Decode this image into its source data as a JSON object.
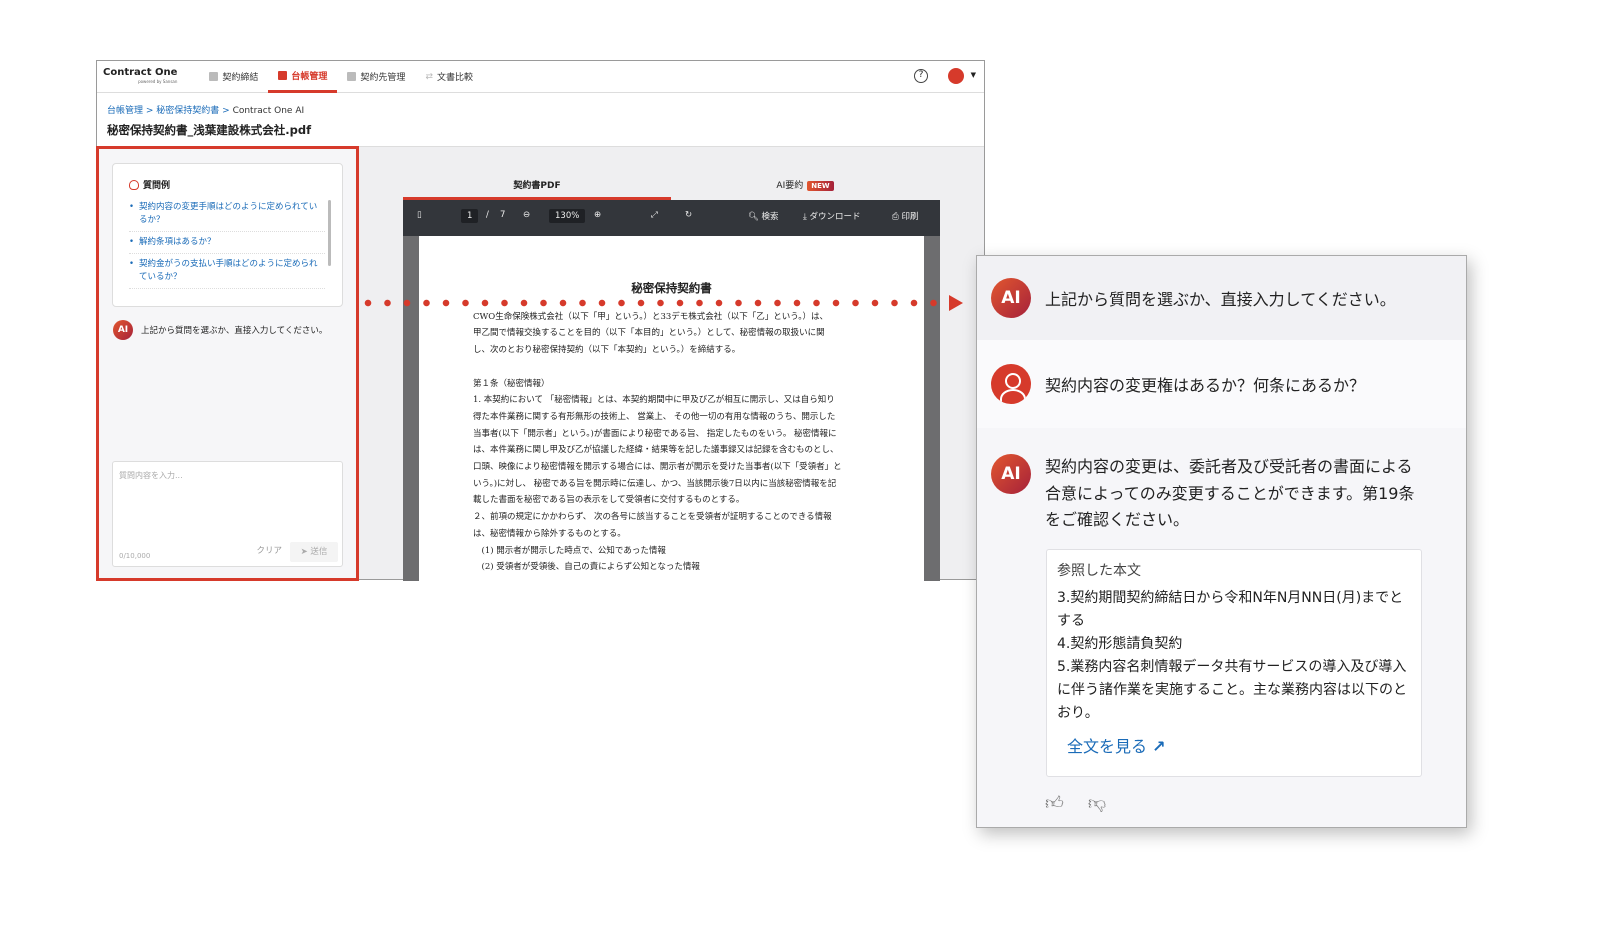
{
  "nav": {
    "logo": "Contract One",
    "logo_sub": "powered by Sansan",
    "items": [
      "契約締結",
      "台帳管理",
      "契約先管理",
      "文書比較"
    ],
    "active": 1,
    "help": "?"
  },
  "breadcrumb": [
    "台帳管理",
    "秘密保持契約書",
    "Contract One AI"
  ],
  "doc_title": "秘密保持契約書_浅葉建設株式会社.pdf",
  "left": {
    "examples_title": "質問例",
    "examples": [
      "契約内容の変更手順はどのように定められているか？",
      "解約条項はあるか？",
      "契約金がうの支払い手順はどのように定められているか？"
    ],
    "ai_badge": "AI",
    "ai_message": "上記から質問を選ぶか、直接入力してください。",
    "input_placeholder": "質問内容を入力...",
    "counter": "0/10,000",
    "clear": "クリア",
    "send": "送信"
  },
  "tabs": {
    "pdf": "契約書PDF",
    "summary": "AI要約",
    "new_badge": "NEW"
  },
  "toolbar": {
    "page": "1",
    "sep": "/",
    "total": "7",
    "zoom": "130%",
    "search": "検索",
    "download": "ダウンロード",
    "print": "印刷"
  },
  "pdf": {
    "title": "秘密保持契約書",
    "lines": [
      "CWO生命保険株式会社（以下「甲」という。）と33デモ株式会社（以下「乙」という。）は、",
      "甲乙間で情報交換することを目的（以下「本目的」という。）として、秘密情報の取扱いに関",
      "し、次のとおり秘密保持契約（以下「本契約」という。）を締結する。",
      "",
      "第１条（秘密情報）",
      "1. 本契約において 「秘密情報」とは、本契約期間中に甲及び乙が相互に開示し、又は自ら知り",
      "得た本件業務に関する有形無形の技術上、 営業上、 その他一切の有用な情報のうち、開示した",
      "当事者(以下「開示者」という。)が書面により秘密である旨、 指定したものをいう。 秘密情報に",
      "は、本件業務に関し甲及び乙が協議した経緯・結果等を記した議事録又は記録を含むものとし、",
      "口頭、映像により秘密情報を開示する場合には、開示者が開示を受けた当事者(以下「受領者」と",
      "いう。)に対し、 秘密である旨を開示時に伝達し、かつ、当該開示後7日以内に当該秘密情報を記",
      "載した書面を秘密である旨の表示をして受領者に交付するものとする。",
      "２、前項の規定にかかわらず、 次の各号に該当することを受領者が証明することのできる情報",
      "は、秘密情報から除外するものとする。",
      "　(1) 開示者が開示した時点で、公知であった情報",
      "　(2) 受領者が受領後、自己の責によらず公知となった情報"
    ]
  },
  "callout": {
    "ai_badge": "AI",
    "msg1": "上記から質問を選ぶか、直接入力してください。",
    "user_msg": "契約内容の変更権はあるか？何条にあるか？",
    "answer": "契約内容の変更は、委託者及び受託者の書面による合意によってのみ変更することができます。第19条をご確認ください。",
    "ref_title": "参照した本文",
    "ref_lines": [
      "3.契約期間契約締結日から令和N年N月NN日(月)までとする",
      "4.契約形態請負契約",
      "5.業務内容名刺情報データ共有サービスの導入及び導入に伴う諸作業を実施すること。主な業務内容は以下のとおり。"
    ],
    "full_text_link": "全文を見る"
  },
  "colors": {
    "accent": "#d63a2b",
    "link": "#1a6bb8",
    "toolbar": "#33363b"
  }
}
